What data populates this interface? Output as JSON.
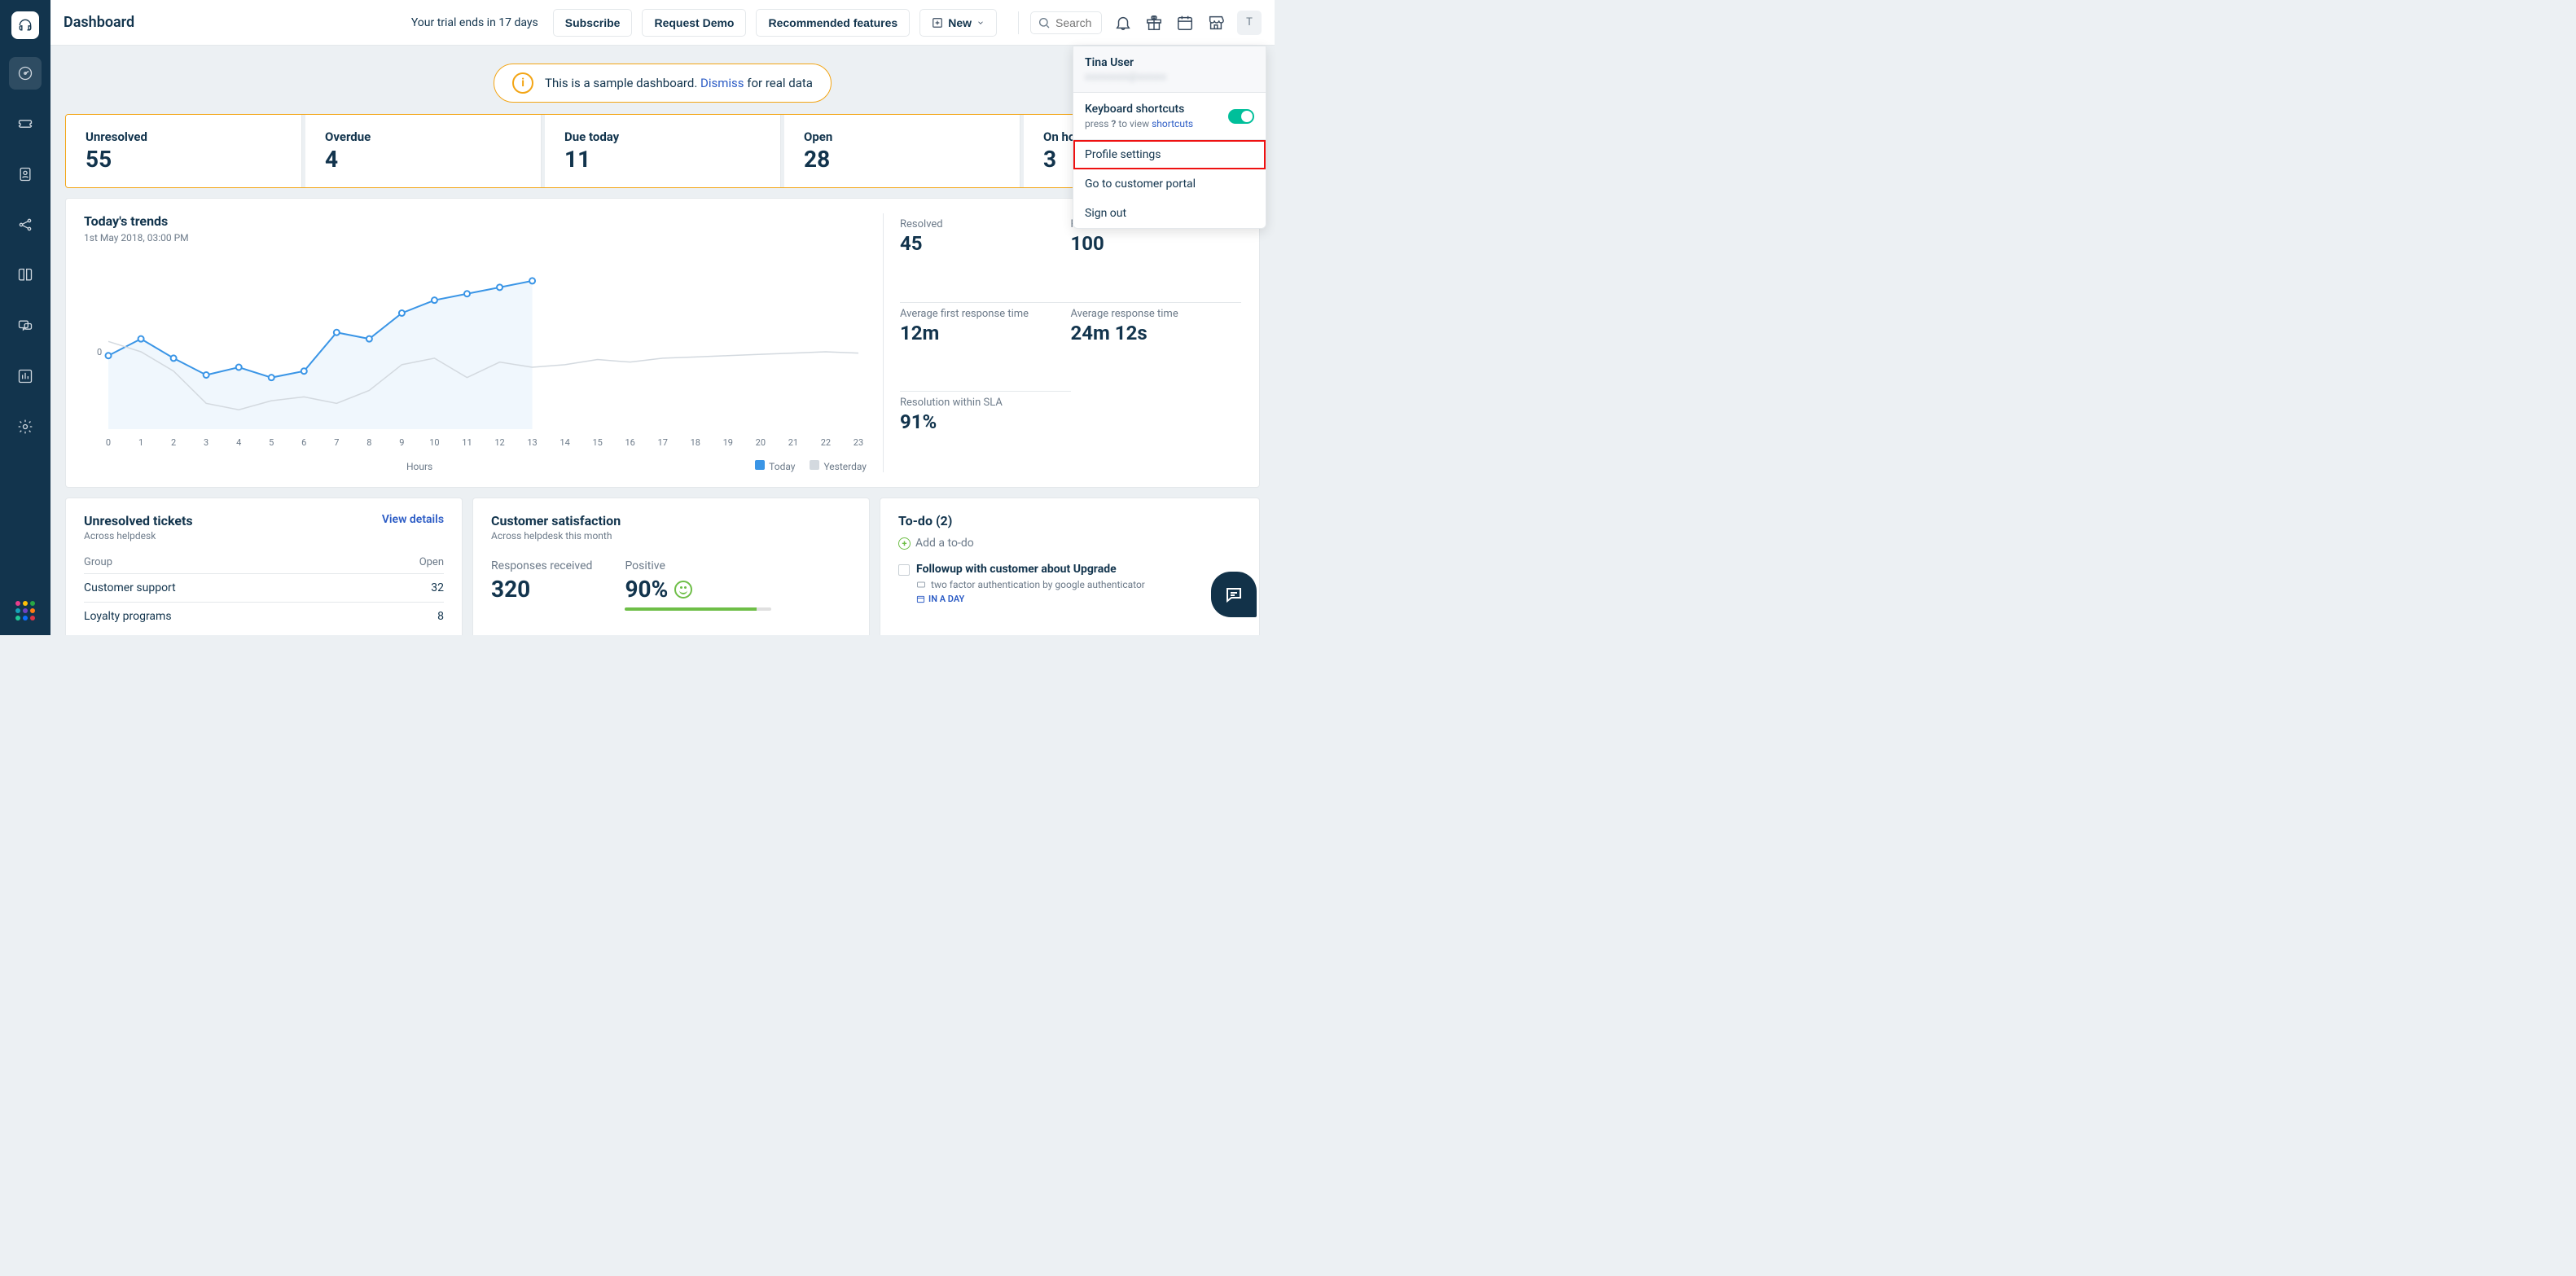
{
  "header": {
    "title": "Dashboard",
    "trial_msg": "Your trial ends in 17 days",
    "subscribe": "Subscribe",
    "request_demo": "Request Demo",
    "recommended": "Recommended features",
    "new_btn": "New",
    "search_placeholder": "Search",
    "avatar_letter": "T"
  },
  "banner": {
    "text": "This is a sample dashboard. ",
    "dismiss": "Dismiss",
    "tail": " for real data"
  },
  "stats": [
    {
      "label": "Unresolved",
      "value": "55"
    },
    {
      "label": "Overdue",
      "value": "4"
    },
    {
      "label": "Due today",
      "value": "11"
    },
    {
      "label": "Open",
      "value": "28"
    },
    {
      "label": "On hold",
      "value": "3"
    }
  ],
  "trends": {
    "title": "Today's trends",
    "subtitle": "1st May 2018, 03:00 PM",
    "xlabel": "Hours",
    "legend_today": "Today",
    "legend_yesterday": "Yesterday",
    "metrics": [
      {
        "label": "Resolved",
        "value": "45"
      },
      {
        "label": "Received",
        "value": "100"
      },
      {
        "label": "Average first response time",
        "value": "12m"
      },
      {
        "label": "Average response time",
        "value": "24m 12s"
      },
      {
        "label": "Resolution within SLA",
        "value": "91%"
      }
    ]
  },
  "unresolved_tickets": {
    "title": "Unresolved tickets",
    "subtitle": "Across helpdesk",
    "view_details": "View details",
    "col_group": "Group",
    "col_open": "Open",
    "rows": [
      {
        "group": "Customer support",
        "open": "32"
      },
      {
        "group": "Loyalty programs",
        "open": "8"
      }
    ]
  },
  "csat": {
    "title": "Customer satisfaction",
    "subtitle": "Across helpdesk this month",
    "responses_label": "Responses received",
    "responses_value": "320",
    "positive_label": "Positive",
    "positive_value": "90%"
  },
  "todo": {
    "title": "To-do (2)",
    "add": "Add a to-do",
    "items": [
      {
        "title": "Followup with customer about Upgrade",
        "meta": "two factor authentication by google authenticator",
        "due": "IN A DAY"
      }
    ]
  },
  "user_menu": {
    "name": "Tina User",
    "kb_title": "Keyboard shortcuts",
    "kb_press": "press ",
    "kb_key": "?",
    "kb_post": " to view ",
    "kb_link": "shortcuts",
    "profile": "Profile settings",
    "portal": "Go to customer portal",
    "signout": "Sign out"
  },
  "chart_data": {
    "type": "line",
    "xlabel": "Hours",
    "x": [
      0,
      1,
      2,
      3,
      4,
      5,
      6,
      7,
      8,
      9,
      10,
      11,
      12,
      13,
      14,
      15,
      16,
      17,
      18,
      19,
      20,
      21,
      22,
      23
    ],
    "y_zero": 0,
    "series": [
      {
        "name": "Today",
        "color": "#3a95e6",
        "values": [
          -3,
          10,
          -5,
          -18,
          -12,
          -20,
          -15,
          15,
          10,
          30,
          40,
          45,
          50,
          55
        ]
      },
      {
        "name": "Yesterday",
        "color": "#d3d9df",
        "values": [
          8,
          0,
          -15,
          -40,
          -45,
          -38,
          -35,
          -40,
          -30,
          -10,
          -5,
          -20,
          -8,
          -12,
          -10,
          -6,
          -8,
          -5,
          -4,
          -3,
          -2,
          -1,
          0,
          -1
        ]
      }
    ],
    "ylim": [
      -60,
      60
    ]
  }
}
